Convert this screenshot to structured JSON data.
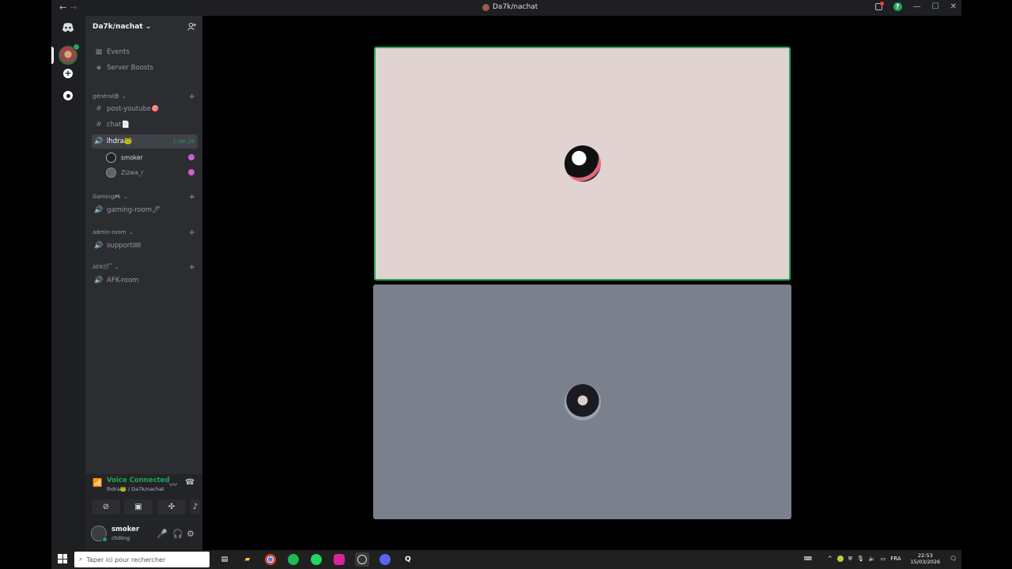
{
  "window": {
    "title": "Da7k/nachat",
    "nav_back": "←",
    "nav_forward": "→"
  },
  "server": {
    "name": "Da7k/nachat",
    "menu_items": [
      {
        "label": "Events"
      },
      {
        "label": "Server Boosts"
      }
    ]
  },
  "categories": [
    {
      "name": "général😄",
      "channels": [
        {
          "type": "text",
          "label": "post-youtube🎯"
        },
        {
          "type": "text",
          "label": "chat📄"
        },
        {
          "type": "voice",
          "label": "lhdra🐸",
          "timer": "1:04:35",
          "active": true,
          "users": [
            {
              "name": "smoker"
            },
            {
              "name": "Zizwa_r"
            }
          ]
        }
      ]
    },
    {
      "name": "Gaming🎮",
      "channels": [
        {
          "type": "voice",
          "label": "gaming-room🖊"
        }
      ]
    },
    {
      "name": "admin-room",
      "channels": [
        {
          "type": "voice",
          "label": "support🎟"
        }
      ]
    },
    {
      "name": "AFK😴",
      "channels": [
        {
          "type": "voice",
          "label": "AFK-room"
        }
      ]
    }
  ],
  "voice_panel": {
    "status": "Voice Connected",
    "location": "lhdra🐸 / Da7k/nachat"
  },
  "user_panel": {
    "name": "smoker",
    "status": "chilling"
  },
  "taskbar": {
    "search_placeholder": "Taper ici pour rechercher",
    "language": "FRA",
    "time": "22:53",
    "date": "15/03/2026"
  },
  "colors": {
    "accent_green": "#23a55a",
    "sidebar": "#2b2d31",
    "guild_bar": "#1e1f22",
    "tile1": "#e0d3d1",
    "tile2": "#7a818d"
  }
}
